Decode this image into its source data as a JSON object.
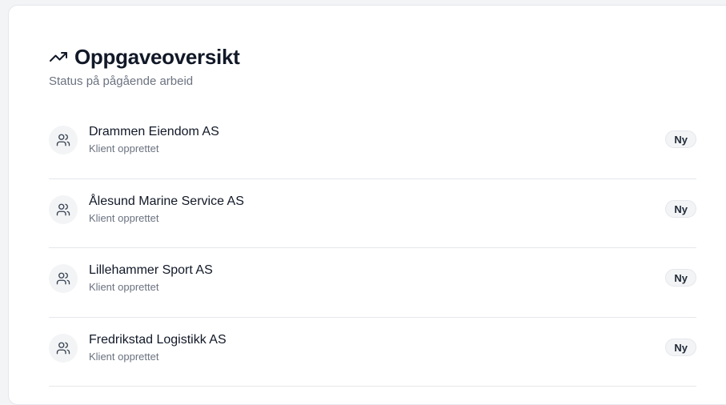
{
  "header": {
    "title": "Oppgaveoversikt",
    "subtitle": "Status på pågående arbeid",
    "icon": "trending-up-icon"
  },
  "tasks": [
    {
      "name": "Drammen Eiendom AS",
      "status": "Klient opprettet",
      "badge": "Ny",
      "icon": "users-icon"
    },
    {
      "name": "Ålesund Marine Service AS",
      "status": "Klient opprettet",
      "badge": "Ny",
      "icon": "users-icon"
    },
    {
      "name": "Lillehammer Sport AS",
      "status": "Klient opprettet",
      "badge": "Ny",
      "icon": "users-icon"
    },
    {
      "name": "Fredrikstad Logistikk AS",
      "status": "Klient opprettet",
      "badge": "Ny",
      "icon": "users-icon"
    }
  ],
  "colors": {
    "title": "#111827",
    "muted": "#6b7280",
    "border": "#e5e7eb",
    "badge_bg": "#f3f4f6"
  }
}
